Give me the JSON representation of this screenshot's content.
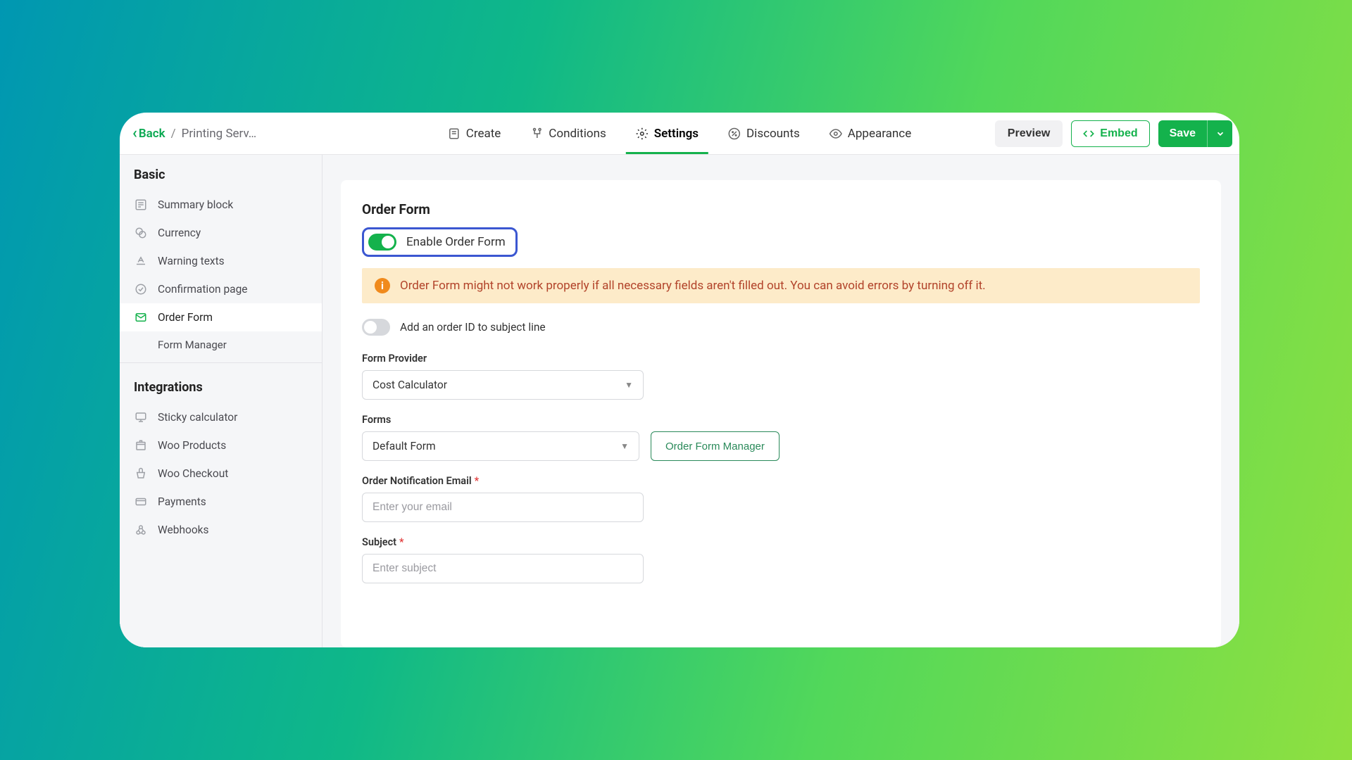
{
  "topbar": {
    "back": "Back",
    "crumb": "Printing Serv…",
    "tabs": {
      "create": "Create",
      "conditions": "Conditions",
      "settings": "Settings",
      "discounts": "Discounts",
      "appearance": "Appearance"
    },
    "preview": "Preview",
    "embed": "Embed",
    "save": "Save"
  },
  "sidebar": {
    "basic_title": "Basic",
    "basic": {
      "summary": "Summary block",
      "currency": "Currency",
      "warning": "Warning texts",
      "confirmation": "Confirmation page",
      "orderform": "Order Form",
      "formmanager": "Form Manager"
    },
    "integrations_title": "Integrations",
    "integrations": {
      "sticky": "Sticky calculator",
      "wooproducts": "Woo Products",
      "woocheckout": "Woo Checkout",
      "payments": "Payments",
      "webhooks": "Webhooks"
    }
  },
  "form": {
    "title": "Order Form",
    "enable_label": "Enable Order Form",
    "alert": "Order Form might not work properly if all necessary fields aren't filled out. You can avoid errors by turning off it.",
    "orderid_label": "Add an order ID to subject line",
    "provider_label": "Form Provider",
    "provider_value": "Cost Calculator",
    "forms_label": "Forms",
    "forms_value": "Default Form",
    "manager_btn": "Order Form Manager",
    "email_label": "Order Notification Email",
    "email_placeholder": "Enter your email",
    "subject_label": "Subject",
    "subject_placeholder": "Enter subject"
  }
}
